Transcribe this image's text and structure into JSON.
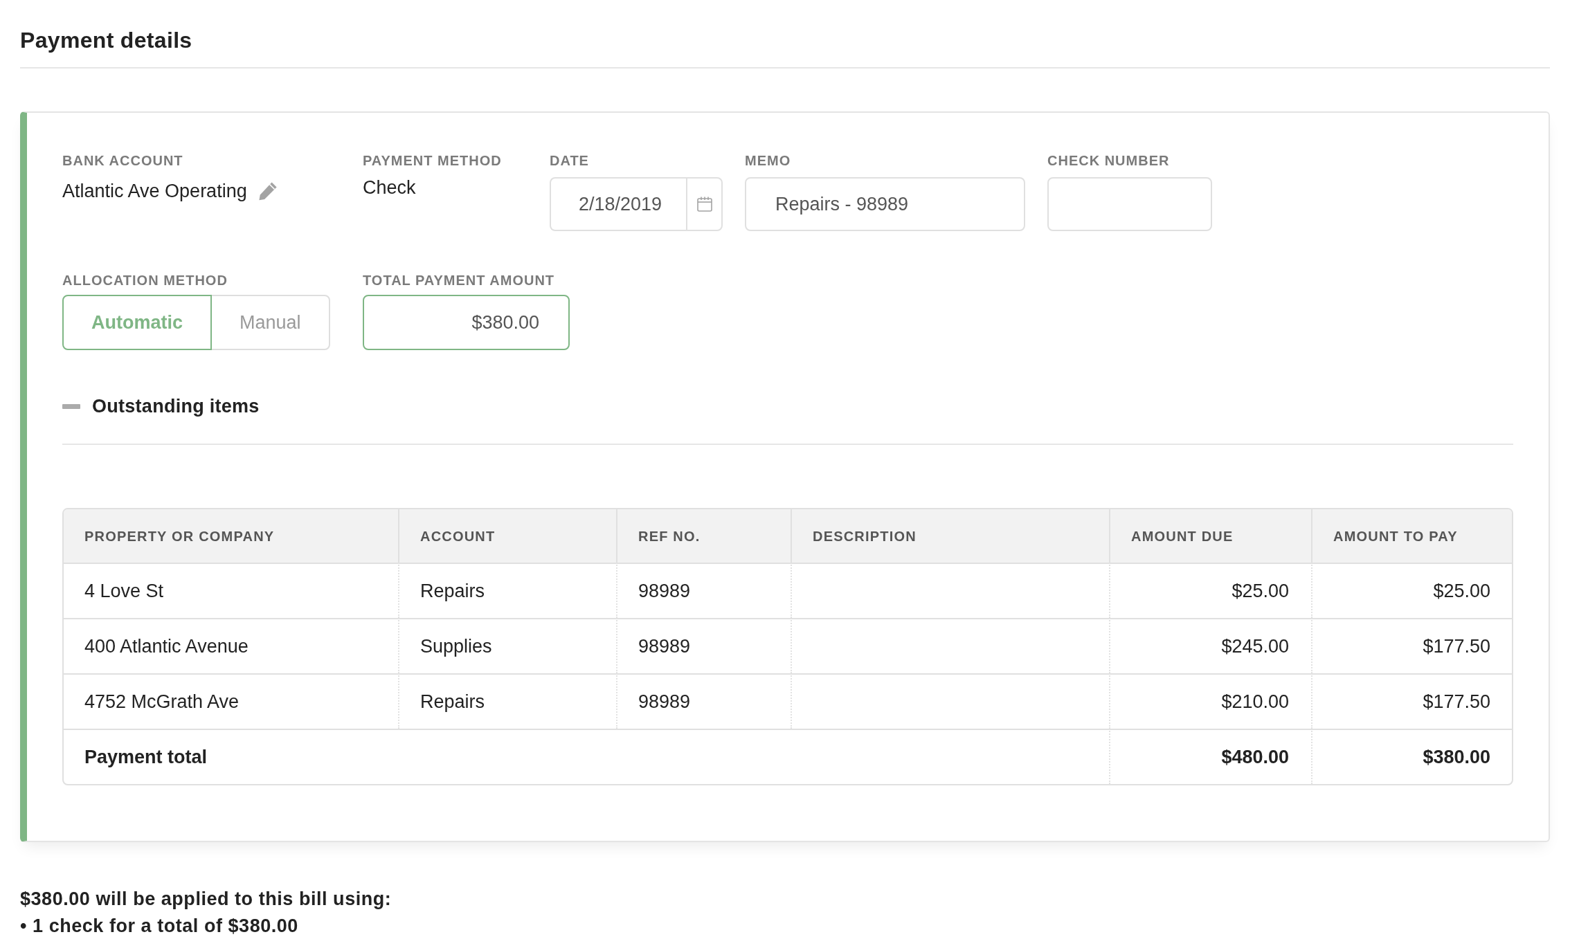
{
  "title": "Payment details",
  "payment": {
    "bank_account": {
      "label": "BANK ACCOUNT",
      "value": "Atlantic Ave Operating"
    },
    "payment_method": {
      "label": "PAYMENT METHOD",
      "value": "Check"
    },
    "date": {
      "label": "DATE",
      "value": "2/18/2019"
    },
    "memo": {
      "label": "MEMO",
      "value": "Repairs - 98989"
    },
    "check_number": {
      "label": "CHECK NUMBER"
    },
    "allocation_method": {
      "label": "ALLOCATION METHOD",
      "options": [
        {
          "label": "Automatic",
          "selected": true
        },
        {
          "label": "Manual",
          "selected": false
        }
      ]
    },
    "total_payment_amount": {
      "label": "TOTAL PAYMENT AMOUNT",
      "value": "$380.00"
    }
  },
  "outstanding_items": {
    "title": "Outstanding items",
    "expanded": true,
    "table": {
      "columns": [
        {
          "label": "PROPERTY OR COMPANY",
          "kind": "text"
        },
        {
          "label": "ACCOUNT",
          "kind": "text"
        },
        {
          "label": "REF NO.",
          "kind": "text"
        },
        {
          "label": "DESCRIPTION",
          "kind": "text"
        },
        {
          "label": "AMOUNT DUE",
          "kind": "amount"
        },
        {
          "label": "AMOUNT TO PAY",
          "kind": "amount"
        }
      ],
      "rows": [
        {
          "property_or_company": "4 Love St",
          "account": "Repairs",
          "ref_no": "98989",
          "amount_due": "$25.00",
          "amount_to_pay": "$25.00"
        },
        {
          "property_or_company": "400 Atlantic Avenue",
          "account": "Supplies",
          "ref_no": "98989",
          "amount_due": "$245.00",
          "amount_to_pay": "$177.50"
        },
        {
          "property_or_company": "4752 McGrath Ave",
          "account": "Repairs",
          "ref_no": "98989",
          "amount_due": "$210.00",
          "amount_to_pay": "$177.50"
        }
      ],
      "total": {
        "label": "Payment total",
        "amount_due": "$480.00",
        "amount_to_pay": "$380.00"
      }
    }
  },
  "summary": {
    "text": "$380.00 will be applied to this bill using:",
    "items": [
      "• 1 check for a total of $380.00"
    ]
  }
}
